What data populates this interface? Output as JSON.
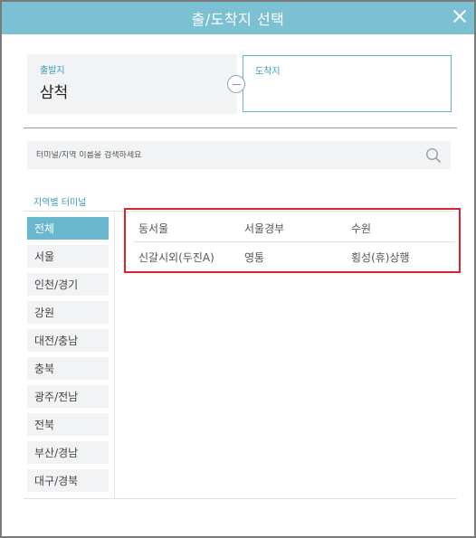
{
  "header": {
    "title": "출/도착지 선택"
  },
  "route": {
    "depart_label": "출발지",
    "depart_value": "삼척",
    "arrive_label": "도착지"
  },
  "search": {
    "placeholder": "터미널/지역 이름을 검색하세요"
  },
  "region_section_title": "지역별 터미널",
  "regions": [
    {
      "label": "전체",
      "active": true
    },
    {
      "label": "서울"
    },
    {
      "label": "인천/경기"
    },
    {
      "label": "강원"
    },
    {
      "label": "대전/충남"
    },
    {
      "label": "충북"
    },
    {
      "label": "광주/전남"
    },
    {
      "label": "전북"
    },
    {
      "label": "부산/경남"
    },
    {
      "label": "대구/경북"
    }
  ],
  "terminals": [
    [
      "동서울",
      "서울경부",
      "수원"
    ],
    [
      "신갈시외(두진A)",
      "영통",
      "횡성(휴)상행"
    ]
  ],
  "colors": {
    "accent": "#7cc0d4",
    "highlight_border": "#d9232d"
  }
}
